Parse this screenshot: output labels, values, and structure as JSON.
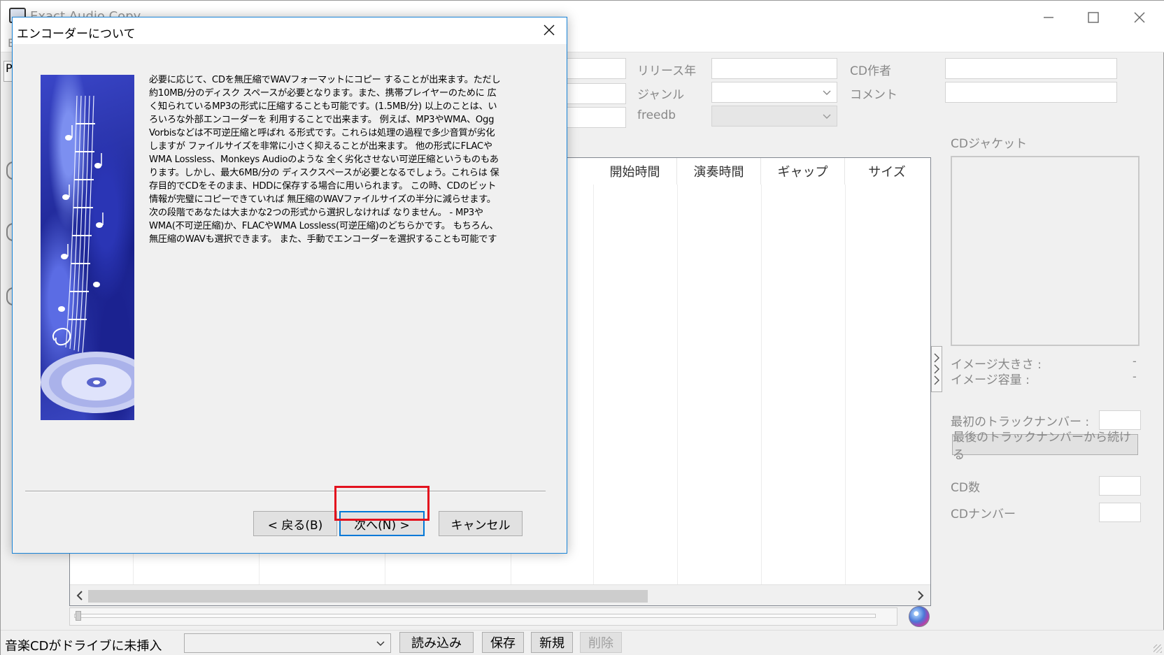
{
  "main_window": {
    "title": "Exact Audio Copy",
    "menu_first": "E",
    "left_tab": "P",
    "fields": {
      "release_year": "リリース年",
      "cd_artist": "CD作者",
      "genre": "ジャンル",
      "comment": "コメント",
      "freedb": "freedb"
    },
    "track_columns": [
      "開始時間",
      "演奏時間",
      "ギャップ",
      "サイズ"
    ],
    "right_panel": {
      "cd_jacket": "CDジャケット",
      "image_size": "イメージ大きさ :",
      "image_size_value": "-",
      "image_capacity": "イメージ容量 :",
      "image_capacity_value": "-",
      "first_track_number": "最初のトラックナンバー :",
      "continue_from_last": "最後のトラックナンバーから続ける",
      "cd_count": "CD数",
      "cd_number": "CDナンバー"
    },
    "status_bar": {
      "status": "音楽CDがドライブに未挿入",
      "load": "読み込み",
      "save": "保存",
      "new": "新規",
      "delete": "削除"
    }
  },
  "dialog": {
    "title": "エンコーダーについて",
    "body": "必要に応じて、CDを無圧縮でWAVフォーマットにコピー することが出来ます。ただし 約10MB/分のディスク スペースが必要となります。また、携帯プレイヤーのために 広く知られているMP3の形式に圧縮することも可能です。(1.5MB/分) 以上のことは、いろいろな外部エンコーダーを 利用することで出来ます。 例えば、MP3やWMA、Ogg Vorbisなどは不可逆圧縮と呼ばれ る形式です。これらは処理の過程で多少音質が劣化しますが ファイルサイズを非常に小さく抑えることが出来ます。 他の形式にFLACやWMA Lossless、Monkeys Audioのような 全く劣化させない可逆圧縮というものもあります。しかし、最大6MB/分の ディスクスペースが必要となるでしょう。これらは 保存目的でCDをそのまま、HDDに保存する場合に用いられます。 この時、CDのビット情報が完璧にコピーできていれば 無圧縮のWAVファイルサイズの半分に減らせます。 次の段階であなたは大まかな2つの形式から選択しなければ なりません。 - MP3やWMA(不可逆圧縮)か、FLACやWMA Lossless(可逆圧縮)のどちらかです。 もちろん、無圧縮のWAVも選択できます。 また、手動でエンコーダーを選択することも可能です",
    "back_button": "< 戻る(B)",
    "next_button": "次へ(N) >",
    "cancel_button": "キャンセル"
  },
  "colors": {
    "highlight": "#e3121e",
    "focus_border": "#0078d7",
    "dialog_border": "#1883d7"
  }
}
